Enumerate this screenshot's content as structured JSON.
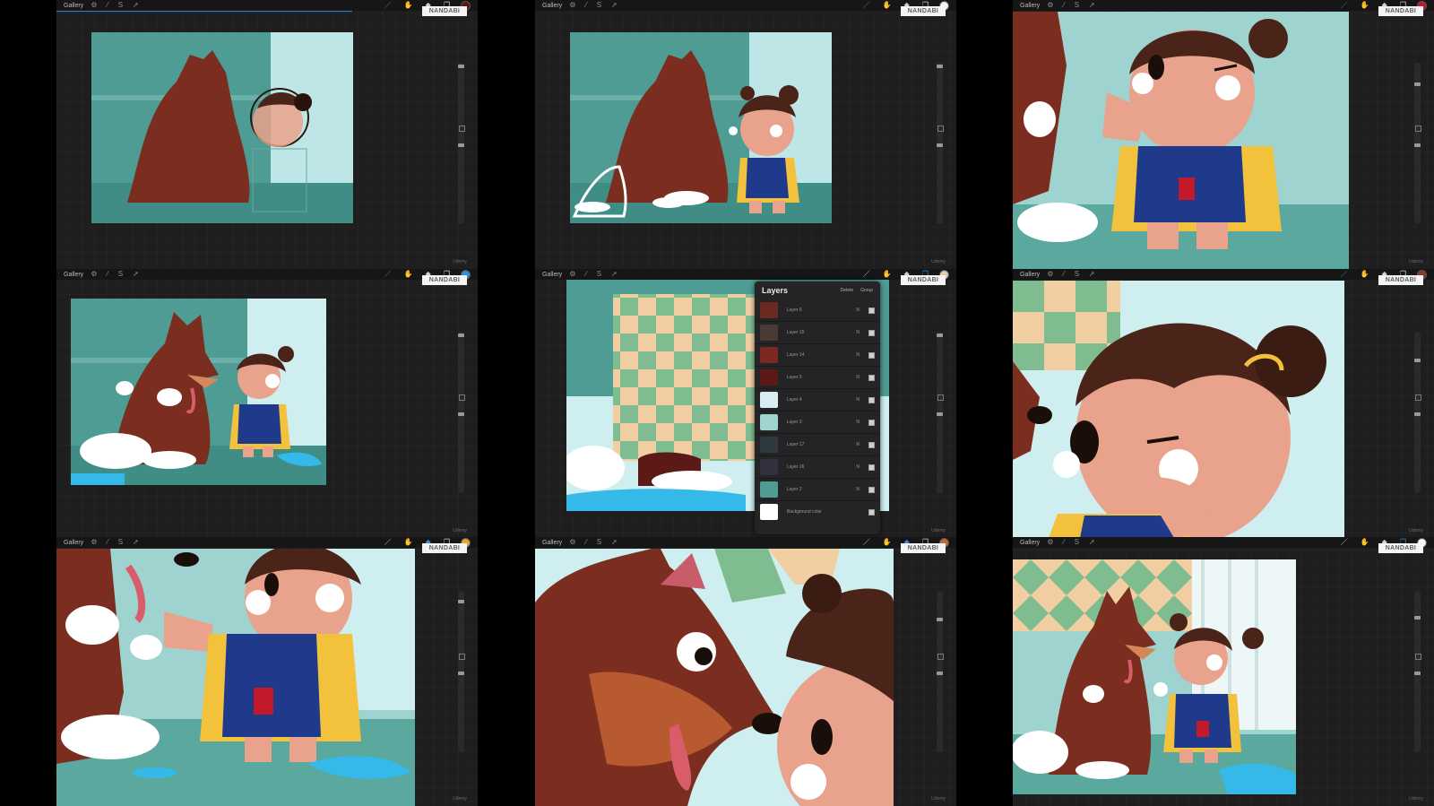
{
  "app": {
    "gallery_label": "Gallery",
    "stamp": "NANDABI",
    "watermark": "Udemy"
  },
  "icons": {
    "left_tools": [
      "wrench-icon",
      "magic-wand-icon",
      "selection-icon",
      "transform-icon"
    ],
    "right_tools": [
      "brush-icon",
      "smudge-icon",
      "eraser-icon",
      "layers-icon"
    ]
  },
  "panels": [
    {
      "id": "p1",
      "color": "#5a1a14",
      "active_tool": 0
    },
    {
      "id": "p2",
      "color": "#f2f2f2",
      "active_tool": 0
    },
    {
      "id": "p3",
      "color": "#c2192b",
      "active_tool": 0
    },
    {
      "id": "p4",
      "color": "#2a8fd6",
      "active_tool": 0
    },
    {
      "id": "p5",
      "color": "#e6c8a8",
      "active_tool": 3
    },
    {
      "id": "p6",
      "color": "#8a3a22",
      "active_tool": 0
    },
    {
      "id": "p7",
      "color": "#e2a92a",
      "active_tool": 2
    },
    {
      "id": "p8",
      "color": "#c06a3a",
      "active_tool": 2
    },
    {
      "id": "p9",
      "color": "#f5f5f5",
      "active_tool": 3
    }
  ],
  "layers_panel": {
    "title": "Layers",
    "delete_label": "Delete",
    "group_label": "Group",
    "items": [
      {
        "name": "Layer 6",
        "mode": "N",
        "thumb": "#6a2a20"
      },
      {
        "name": "Layer 15",
        "mode": "N",
        "thumb": "#4a3a34"
      },
      {
        "name": "Layer 14",
        "mode": "N",
        "thumb": "#7a2a1e"
      },
      {
        "name": "Layer 5",
        "mode": "N",
        "thumb": "#5b1a15"
      },
      {
        "name": "Layer 4",
        "mode": "N",
        "thumb": "#d9ecf2"
      },
      {
        "name": "Layer 3",
        "mode": "N",
        "thumb": "#9fd3d0"
      },
      {
        "name": "Layer 17",
        "mode": "N",
        "thumb": "#2e3a40"
      },
      {
        "name": "Layer 16",
        "mode": "N",
        "thumb": "#343040"
      },
      {
        "name": "Layer 2",
        "mode": "N",
        "thumb": "#4f9d92"
      }
    ],
    "background": {
      "name": "Background color",
      "thumb": "#ffffff"
    }
  },
  "colors": {
    "wall_teal": "#4e9c93",
    "floor_teal": "#3f8d84",
    "dog_brown": "#7b2e1f",
    "skin": "#e9a28c",
    "hair": "#4a2418",
    "apron_blue": "#1f3a8a",
    "shirt_yellow": "#f3c23c",
    "water_blue": "#35b9e9",
    "foam_white": "#ffffff",
    "curtain": "#cfeeef",
    "checker_cream": "#f1cfa3",
    "checker_green": "#7fbd91"
  }
}
